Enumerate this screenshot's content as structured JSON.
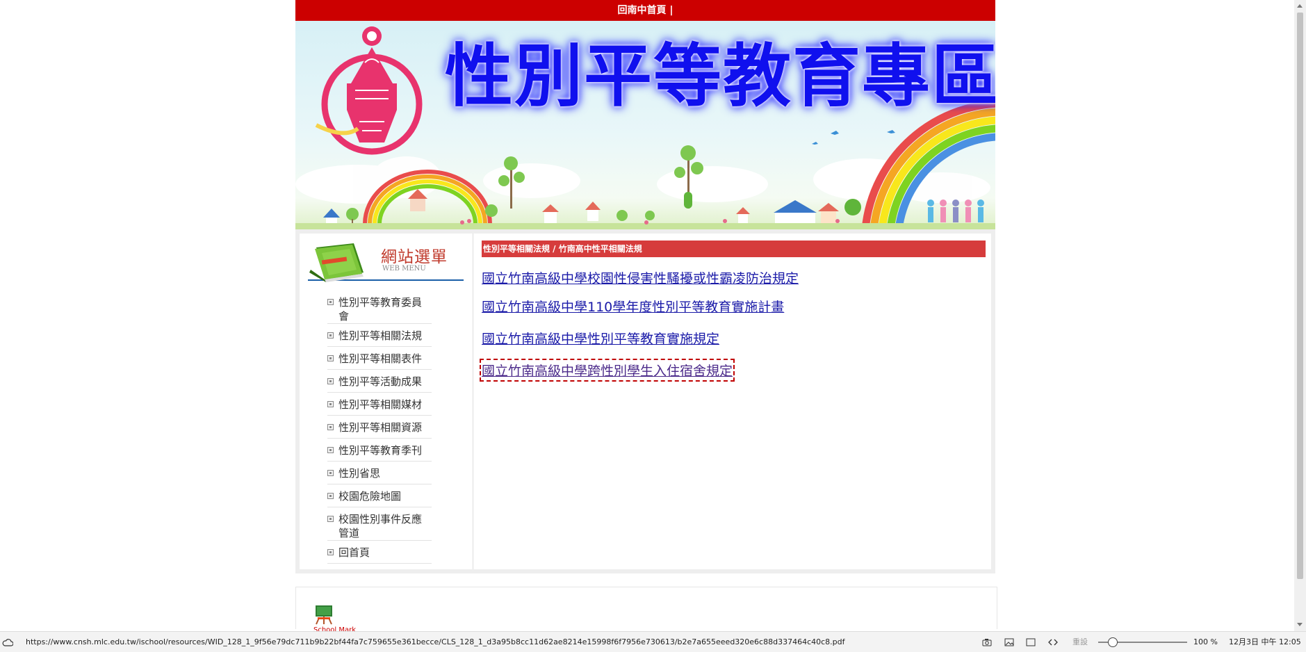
{
  "topbar": {
    "home_link": "回南中首頁 |"
  },
  "banner": {
    "title": "性別平等教育專區"
  },
  "sidebar": {
    "title": "網站選單",
    "subtitle": "WEB MENU",
    "items": [
      {
        "label": "性別平等教育委員會"
      },
      {
        "label": "性別平等相關法規"
      },
      {
        "label": "性別平等相關表件"
      },
      {
        "label": "性別平等活動成果"
      },
      {
        "label": "性別平等相關媒材"
      },
      {
        "label": "性別平等相關資源"
      },
      {
        "label": "性別平等教育季刊"
      },
      {
        "label": "性別省思"
      },
      {
        "label": "校園危險地圖"
      },
      {
        "label": "校園性別事件反應管道"
      },
      {
        "label": "回首頁"
      }
    ]
  },
  "main": {
    "breadcrumb": "性別平等相關法規 / 竹南高中性平相關法規",
    "links": [
      {
        "label": "國立竹南高級中學校園性侵害性騷擾或性霸凌防治規定"
      },
      {
        "label": "國立竹南高級中學110學年度性別平等教育實施計畫"
      },
      {
        "label": "國立竹南高級中學性別平等教育實施規定"
      },
      {
        "label": "國立竹南高級中學跨性別學生入住宿舍規定"
      }
    ]
  },
  "footer": {
    "mark_text": "School Mark"
  },
  "statusbar": {
    "url": "https://www.cnsh.mlc.edu.tw/ischool/resources/WID_128_1_9f56e79dc711b9b22bf44fa7c759655e361becce/CLS_128_1_d3a95b8cc11d62ae8214e15998f6f7956e730613/b2e7a655eeed320e6c88d337464c40c8.pdf",
    "reset_label": "重設",
    "zoom": "100 %",
    "datetime": "12月3日 中午 12:05"
  },
  "colors": {
    "topbar": "#cc0000",
    "banner_title": "#1010ee",
    "breadcrumb_bg": "#d63c3c",
    "link": "#1a1aa8"
  }
}
